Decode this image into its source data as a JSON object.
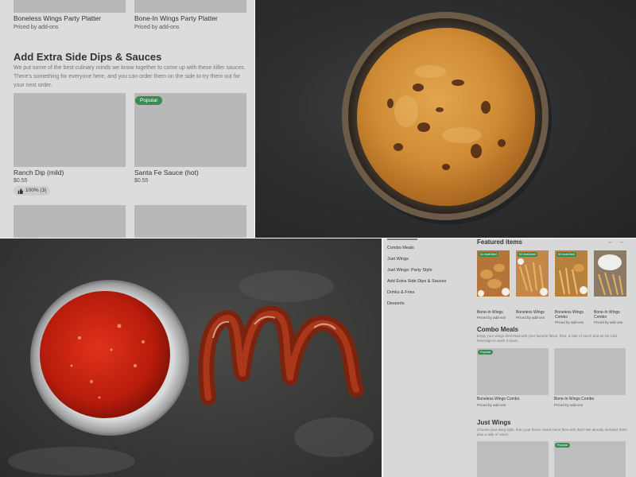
{
  "top_left": {
    "top_items": [
      {
        "name": "Boneless Wings Party Platter",
        "price": "Priced by add-ons"
      },
      {
        "name": "Bone-In Wings Party Platter",
        "price": "Priced by add-ons"
      }
    ],
    "section_title": "Add Extra Side Dips & Sauces",
    "section_desc": "We put some of the best culinary minds we know together to come up with these killer sauces. There's something for everyone here, and you can order them on the side to try them out for your next order.",
    "items": [
      {
        "name": "Ranch Dip (mild)",
        "price": "$0.55",
        "rating": "100% (3)"
      },
      {
        "name": "Santa Fe Sauce (hot)",
        "price": "$0.55",
        "badge": "Popular"
      }
    ]
  },
  "bottom_right": {
    "nav": [
      "Combo Meals",
      "Just Wings",
      "Just Wings: Party Style",
      "Add Extra Side Dips & Sauces",
      "Drinks & Fries",
      "Desserts"
    ],
    "featured_title": "Featured items",
    "featured": [
      {
        "name": "Bone-In Wings",
        "price": "Priced by add-ons",
        "badge": "#1 most liked"
      },
      {
        "name": "Boneless Wings",
        "price": "Priced by add-ons",
        "badge": "#2 most liked"
      },
      {
        "name": "Boneless Wings Combo",
        "price": "Priced by add-ons",
        "badge": "#3 most liked"
      },
      {
        "name": "Bone-In Wings Combo",
        "price": "Priced by add-ons",
        "badge": ""
      }
    ],
    "combo_title": "Combo Meals",
    "combo_desc": "Enjoy your wings drenched with your favorite flavor, fries, a side of ranch and an ice cold beverage to wash it down.",
    "combo_items": [
      {
        "name": "Boneless Wings Combo",
        "price": "Priced by add-ons",
        "badge": "Popular"
      },
      {
        "name": "Bone-In Wings Combo",
        "price": "Priced by add-ons",
        "badge": ""
      }
    ],
    "wings_title": "Just Wings",
    "wings_desc": "Choose your wing style, then your flavor. Need some fries with that? We already included them plus a side of ranch.",
    "wings_badge": "Popular"
  }
}
